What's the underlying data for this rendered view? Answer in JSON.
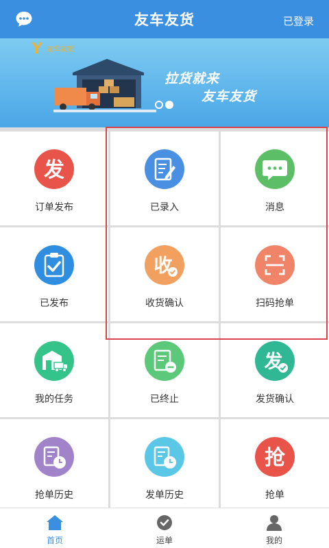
{
  "header": {
    "title": "友车友货",
    "login_status": "已登录"
  },
  "banner": {
    "logo_text": "友车友货",
    "slogan_line1": "拉货就来",
    "slogan_line2": "友车友货",
    "active_slide": 2,
    "slide_count": 2
  },
  "grid": {
    "items": [
      {
        "label": "订单发布",
        "icon": "fa-badge-icon",
        "color": "#e8534a"
      },
      {
        "label": "已录入",
        "icon": "edit-document-icon",
        "color": "#4a90e2"
      },
      {
        "label": "消息",
        "icon": "message-bubble-icon",
        "color": "#5cbf68"
      },
      {
        "label": "已发布",
        "icon": "clipboard-check-icon",
        "color": "#2f8ee0"
      },
      {
        "label": "收货确认",
        "icon": "shou-check-icon",
        "color": "#f2a060"
      },
      {
        "label": "扫码抢单",
        "icon": "scan-icon",
        "color": "#f08468"
      },
      {
        "label": "我的任务",
        "icon": "warehouse-truck-icon",
        "color": "#34c48a"
      },
      {
        "label": "已终止",
        "icon": "document-minus-icon",
        "color": "#5cc97a"
      },
      {
        "label": "发货确认",
        "icon": "fa-check-icon",
        "color": "#2fb893"
      },
      {
        "label": "抢单历史",
        "icon": "history-clock-icon",
        "color": "#a083c9"
      },
      {
        "label": "发单历史",
        "icon": "history-clock-icon",
        "color": "#5bc7e6"
      },
      {
        "label": "抢单",
        "icon": "qiang-badge-icon",
        "color": "#e8534a"
      }
    ]
  },
  "tabbar": {
    "items": [
      {
        "label": "首页",
        "icon": "home-icon",
        "active": true
      },
      {
        "label": "运单",
        "icon": "waybill-check-icon",
        "active": false
      },
      {
        "label": "我的",
        "icon": "user-icon",
        "active": false
      }
    ]
  },
  "colors": {
    "header_bg": "#3a8fe0",
    "highlight_border": "#d9434a",
    "active_tab": "#3a8fe0"
  }
}
